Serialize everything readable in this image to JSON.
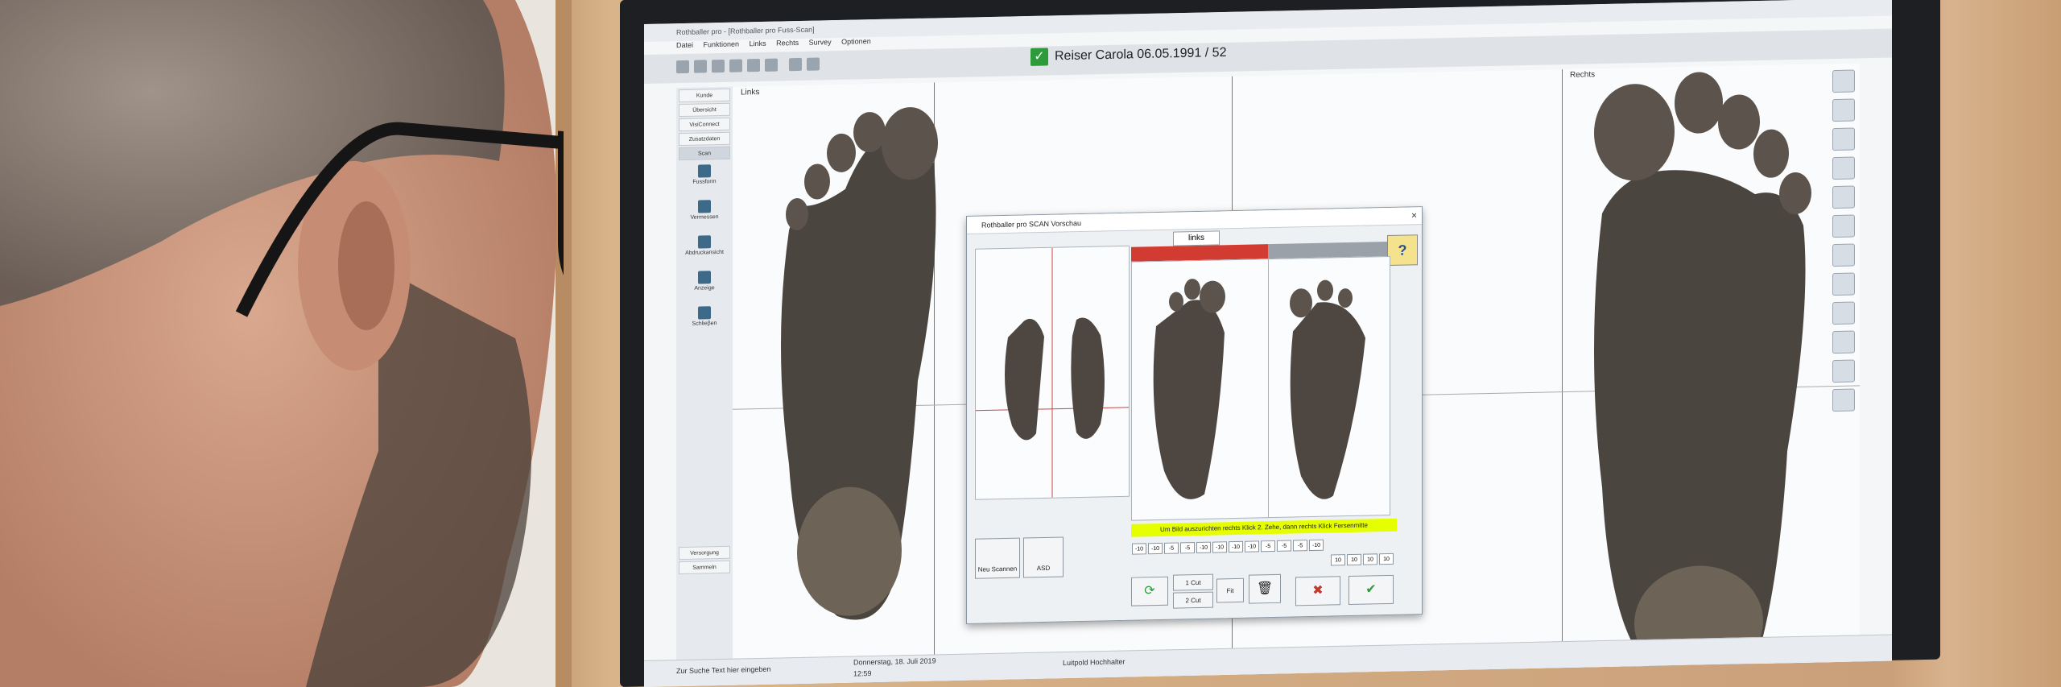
{
  "app": {
    "window_title": "Rothballer pro - [Rothballer pro Fuss-Scan]",
    "menu": [
      "Datei",
      "Funktionen",
      "Links",
      "Rechts",
      "Survey",
      "Optionen"
    ],
    "patient": "Reiser Carola 06.05.1991 / 52"
  },
  "sidebar": {
    "buttons": [
      "Kunde",
      "Übersicht",
      "VisiConnect",
      "Zusatzdaten",
      "Scan"
    ],
    "items": [
      "Fussform",
      "Vermessen",
      "Abdruckansicht",
      "Anzeige",
      "Schlieβen"
    ],
    "bottom": [
      "Versorgung",
      "Sammeln"
    ]
  },
  "canvas": {
    "left_label": "Links",
    "right_label": "Rechts"
  },
  "dialog": {
    "title": "Rothballer pro SCAN Vorschau",
    "close": "×",
    "tab": "links",
    "help": "?",
    "instruction": "Um Bild auszurichten rechts Klick 2. Zehe, dann rechts Klick Fersenmitte",
    "nums_row1": [
      "-10",
      "-10",
      "-5",
      "-5",
      "-10",
      "-10",
      "-10",
      "-10",
      "-5",
      "-5",
      "-5",
      "-10"
    ],
    "nums_row2": [
      "10",
      "10",
      "10",
      "10"
    ],
    "btn_scan": "Neu Scannen",
    "btn_asd": "ASD",
    "btn_1cut": "1 Cut",
    "btn_2cut": "2 Cut",
    "btn_fit": "Fit"
  },
  "taskbar": {
    "search": "Zur Suche Text hier eingeben",
    "date": "Donnerstag, 18. Juli 2019",
    "time": "12:59",
    "user": "Luitpold Hochhalter"
  },
  "colors": {
    "accent_green": "#2e9b3a",
    "red_bar": "#d23b32",
    "instruction_yellow": "#e6ff00"
  }
}
